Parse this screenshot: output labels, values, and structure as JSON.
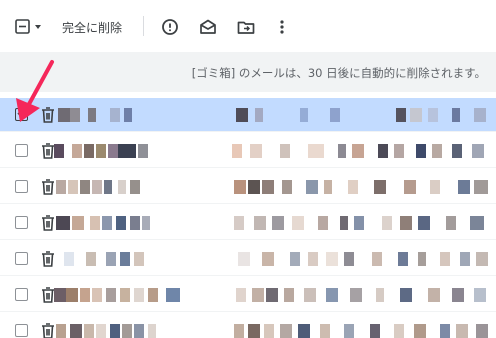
{
  "toolbar": {
    "delete_forever_label": "完全に削除",
    "icons": [
      "checkbox-select-icon",
      "chevron-down-icon",
      "report-spam-icon",
      "mark-unread-icon",
      "move-to-icon",
      "more-vert-icon"
    ]
  },
  "notice": {
    "text": "[ゴミ箱] のメールは、30 日後に自動的に削除されます。"
  },
  "colors": {
    "accent_arrow": "#f5275a",
    "selected_row": "#c2dbff",
    "notice_bg": "#f1f3f4"
  },
  "rows": [
    {
      "selected": true
    },
    {
      "selected": false
    },
    {
      "selected": false
    },
    {
      "selected": false
    },
    {
      "selected": false
    },
    {
      "selected": false
    },
    {
      "selected": false
    }
  ]
}
